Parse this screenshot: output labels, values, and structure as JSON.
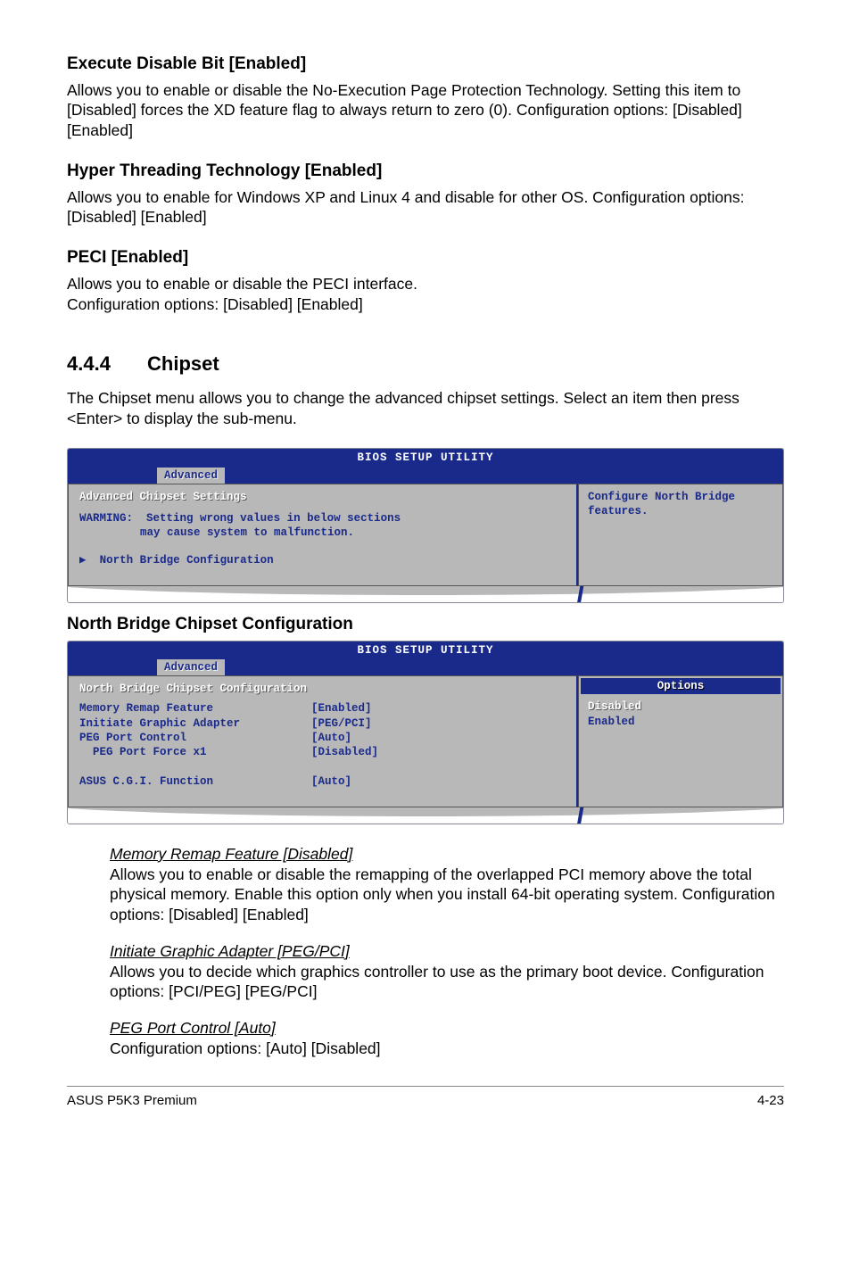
{
  "s1": {
    "title": "Execute Disable Bit [Enabled]",
    "body": "Allows you to enable or disable the No-Execution Page Protection Technology. Setting this item to [Disabled] forces the XD feature flag to always return to zero (0). Configuration options: [Disabled] [Enabled]"
  },
  "s2": {
    "title": "Hyper Threading Technology [Enabled]",
    "body": "Allows you to enable for Windows XP and Linux 4 and disable for other OS. Configuration options: [Disabled] [Enabled]"
  },
  "s3": {
    "title": "PECI [Enabled]",
    "body1": "Allows you to enable or disable the PECI interface.",
    "body2": "Configuration options: [Disabled] [Enabled]"
  },
  "chipset": {
    "num": "4.4.4",
    "title": "Chipset",
    "intro": "The Chipset menu allows you to change the advanced chipset settings. Select an item then press <Enter> to display the sub-menu."
  },
  "bios1": {
    "header": "BIOS SETUP UTILITY",
    "tab": "Advanced",
    "left_title": "Advanced Chipset Settings",
    "warn_prefix": "WARMING:",
    "warn_line1": "Setting wrong values in below sections",
    "warn_line2": "may cause system to malfunction.",
    "arrow_prefix": "▶",
    "nav_item": "North Bridge Configuration",
    "right1": "Configure North Bridge",
    "right2": "features."
  },
  "nbcc_title": "North Bridge Chipset Configuration",
  "bios2": {
    "header": "BIOS SETUP UTILITY",
    "tab": "Advanced",
    "left_title": "North Bridge Chipset Configuration",
    "rows": [
      {
        "label": "Memory Remap Feature",
        "value": "[Enabled]"
      },
      {
        "label": "Initiate Graphic Adapter",
        "value": "[PEG/PCI]"
      },
      {
        "label": "PEG Port Control",
        "value": "[Auto]"
      },
      {
        "label": "  PEG Port Force x1",
        "value": "[Disabled]"
      },
      {
        "label": "",
        "value": ""
      },
      {
        "label": "ASUS C.G.I. Function",
        "value": "[Auto]"
      }
    ],
    "options_title": "Options",
    "opt_sel": "Disabled",
    "opt2": "Enabled"
  },
  "sub1": {
    "title": "Memory Remap Feature [Disabled]",
    "body": "Allows you to enable or disable the remapping of the overlapped PCI memory above the total physical memory. Enable this option only when you install 64-bit operating system. Configuration options: [Disabled] [Enabled]"
  },
  "sub2": {
    "title": "Initiate Graphic Adapter [PEG/PCI]",
    "body": "Allows you to decide which graphics controller to use as the primary boot device. Configuration options: [PCI/PEG] [PEG/PCI]"
  },
  "sub3": {
    "title": "PEG Port Control [Auto]",
    "body": "Configuration options: [Auto] [Disabled]"
  },
  "footer": {
    "left": "ASUS P5K3 Premium",
    "right": "4-23"
  }
}
